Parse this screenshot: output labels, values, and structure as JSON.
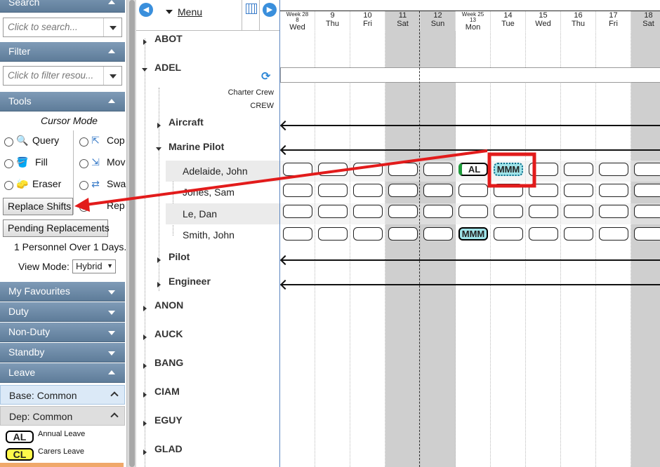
{
  "left_panel": {
    "search": {
      "title": "Search",
      "placeholder": "Click to search..."
    },
    "filter": {
      "title": "Filter",
      "placeholder": "Click to filter resou..."
    },
    "tools": {
      "title": "Tools",
      "cursor_mode_label": "Cursor Mode",
      "modes_left": [
        "Query",
        "Fill",
        "Eraser"
      ],
      "modes_right": [
        "Cop",
        "Mov",
        "Swa",
        "Rep"
      ],
      "selected_mode": "Rep",
      "replace_shifts_button": "Replace Shifts",
      "pending_replacements_button": "Pending Replacements",
      "status_text": "1 Personnel Over 1 Days.",
      "view_mode_label": "View Mode:",
      "view_mode_value": "Hybrid"
    },
    "sections": [
      "My Favourites",
      "Duty",
      "Non-Duty",
      "Standby",
      "Leave"
    ],
    "base_common": "Base: Common",
    "dep_common": "Dep: Common",
    "leave_items": [
      {
        "code": "AL",
        "name": "Annual Leave"
      },
      {
        "code": "CL",
        "name": "Carers Leave"
      }
    ]
  },
  "tree": {
    "menu_label": "Menu",
    "charter_crew": "Charter Crew",
    "crew": "CREW",
    "bases": [
      "ABOT",
      "ADEL",
      "ANON",
      "AUCK",
      "BANG",
      "CIAM",
      "EGUY",
      "GLAD"
    ],
    "groups": [
      "Aircraft",
      "Marine Pilot",
      "Pilot",
      "Engineer"
    ],
    "people": [
      "Adelaide, John",
      "Jones, Sam",
      "Le, Dan",
      "Smith, John"
    ]
  },
  "schedule": {
    "days": [
      {
        "week": "Week 28",
        "num": "8",
        "dow": "Wed",
        "weekend": false
      },
      {
        "week": "",
        "num": "9",
        "dow": "Thu",
        "weekend": false
      },
      {
        "week": "",
        "num": "10",
        "dow": "Fri",
        "weekend": false
      },
      {
        "week": "",
        "num": "11",
        "dow": "Sat",
        "weekend": true
      },
      {
        "week": "",
        "num": "12",
        "dow": "Sun",
        "weekend": true
      },
      {
        "week": "Week 25",
        "num": "13",
        "dow": "Mon",
        "weekend": false
      },
      {
        "week": "",
        "num": "14",
        "dow": "Tue",
        "weekend": false
      },
      {
        "week": "",
        "num": "15",
        "dow": "Wed",
        "weekend": false
      },
      {
        "week": "",
        "num": "16",
        "dow": "Thu",
        "weekend": false
      },
      {
        "week": "",
        "num": "17",
        "dow": "Fri",
        "weekend": false
      },
      {
        "week": "",
        "num": "18",
        "dow": "Sat",
        "weekend": true
      }
    ],
    "assignments": [
      {
        "person": "Adelaide, John",
        "day": "13",
        "code": "AL"
      },
      {
        "person": "Adelaide, John",
        "day": "14",
        "code": "MMM",
        "highlighted": true
      },
      {
        "person": "Smith, John",
        "day": "13",
        "code": "MMM"
      }
    ]
  },
  "colors": {
    "panel_header": "#6e8aa7",
    "weekend": "#cfcfcf",
    "mmm_fill": "#9fe3e8",
    "annotation_red": "#e21b1b"
  }
}
